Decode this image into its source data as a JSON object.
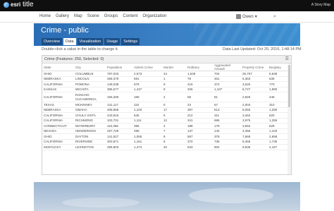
{
  "header": {
    "brand": "esri",
    "title": "title",
    "story_map_link": "A Story Map"
  },
  "nav": {
    "links": [
      "Home",
      "Gallery",
      "Map",
      "Scene",
      "Groups",
      "Content",
      "Organization"
    ],
    "user": "Owen"
  },
  "item": {
    "title": "Crime - public"
  },
  "tabs": [
    "Overview",
    "Data",
    "Visualization",
    "Usage",
    "Settings"
  ],
  "active_tab": "Data",
  "hint": "Double-click a value in the table to change it.",
  "last_updated": "Data Last Updated: Oct 20, 2016, 1:48:14 PM",
  "table": {
    "title": "Crime (Features: 250, Selected: 0)",
    "columns": [
      "State",
      "City",
      "Population",
      "Violent Crime",
      "Murder",
      "Robbery",
      "Aggravated Assault",
      "Property Crime",
      "Burglary"
    ],
    "rows": [
      [
        "OHIO",
        "COLUMBUS",
        "787,033",
        "2,573",
        "44",
        "1,548",
        "704",
        "25,707",
        "6,638"
      ],
      [
        "NEBRASKA",
        "LINCOLN",
        "258,379",
        "591",
        "1",
        "79",
        "461",
        "6,363",
        "638"
      ],
      [
        "CALIFORNIA",
        "POMONA",
        "149,038",
        "879",
        "9",
        "416",
        "372",
        "3,525",
        "770"
      ],
      [
        "KANSAS",
        "WICHITA",
        "385,577",
        "1,437",
        "9",
        "206",
        "1,107",
        "8,727",
        "1,990"
      ],
      [
        "CALIFORNIA",
        "RANCHO CUCAMONGA",
        "165,269",
        "168",
        "2",
        "58",
        "81",
        "2,826",
        "446"
      ],
      [
        "TEXAS",
        "MCKINNEY",
        "131,117",
        "110",
        "0",
        "23",
        "67",
        "2,003",
        "310"
      ],
      [
        "NEBRASKA",
        "OMAHA",
        "408,958",
        "1,103",
        "17",
        "397",
        "613",
        "8,093",
        "1,290"
      ],
      [
        "CALIFORNIA",
        "CHULA VISTA",
        "243,916",
        "545",
        "5",
        "212",
        "311",
        "3,462",
        "620"
      ],
      [
        "CALIFORNIA",
        "RICHMOND",
        "103,701",
        "1,111",
        "12",
        "341",
        "686",
        "3,975",
        "1,256"
      ],
      [
        "CONNECTICUT",
        "WATERBURY",
        "110,366",
        "396",
        "4",
        "188",
        "179",
        "3,662",
        "629"
      ],
      [
        "NEVADA",
        "HENDERSON",
        "257,729",
        "298",
        "7",
        "137",
        "140",
        "4,355",
        "1,103"
      ],
      [
        "OHIO",
        "DAYTON",
        "141,527",
        "1,055",
        "9",
        "567",
        "378",
        "7,669",
        "2,658"
      ],
      [
        "CALIFORNIA",
        "RIVERSIDE",
        "303,871",
        "1,161",
        "6",
        "370",
        "736",
        "8,456",
        "1,735"
      ],
      [
        "KENTUCKY",
        "LEXINGTON",
        "295,803",
        "1,474",
        "20",
        "533",
        "904",
        "9,936",
        "2,157"
      ]
    ]
  }
}
